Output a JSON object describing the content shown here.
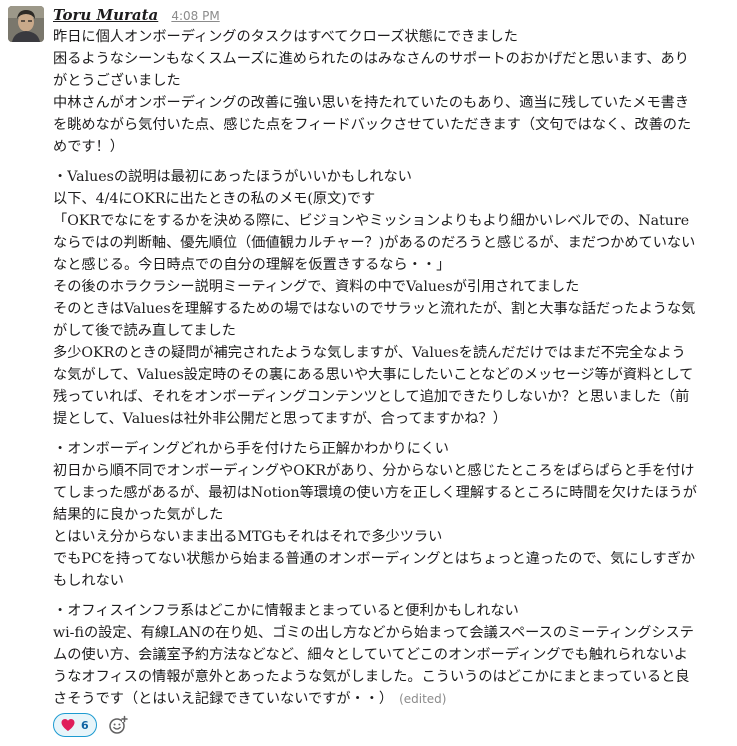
{
  "message": {
    "author": "Toru Murata",
    "timestamp": "4:08 PM",
    "paragraphs": [
      {
        "lines": [
          "昨日に個人オンボーディングのタスクはすべてクローズ状態にできました",
          "困るようなシーンもなくスムーズに進められたのはみなさんのサポートのおかげだと思います、あり",
          "がとうございました",
          "中林さんがオンボーディングの改善に強い思いを持たれていたのもあり、適当に残していたメモ書き",
          "を眺めながら気付いた点、感じた点をフィードバックさせていただきます（文句ではなく、改善のた",
          "めです！）"
        ]
      },
      {
        "lines": [
          "・Valuesの説明は最初にあったほうがいいかもしれない",
          "以下、4/4にOKRに出たときの私のメモ(原文)です",
          "「OKRでなにをするかを決める際に、ビジョンやミッションよりもより細かいレベルでの、Nature",
          "ならではの判断軸、優先順位（価値観カルチャー？)があるのだろうと感じるが、まだつかめていない",
          "なと感じる。今日時点での自分の理解を仮置きするなら・・」",
          "その後のホラクラシー説明ミーティングで、資料の中でValuesが引用されてました",
          "そのときはValuesを理解するための場ではないのでサラッと流れたが、割と大事な話だったような気",
          "がして後で読み直してました",
          "多少OKRのときの疑問が補完されたような気しますが、Valuesを読んだだけではまだ不完全なよう",
          "な気がして、Values設定時のその裏にある思いや大事にしたいことなどのメッセージ等が資料として",
          "残っていれば、それをオンボーディングコンテンツとして追加できたりしないか？と思いました（前",
          "提として、Valuesは社外非公開だと思ってますが、合ってますかね？）"
        ]
      },
      {
        "lines": [
          "・オンボーディングどれから手を付けたら正解かわかりにくい",
          "初日から順不同でオンボーディングやOKRがあり、分からないと感じたところをぱらぱらと手を付け",
          "てしまった感があるが、最初はNotion等環境の使い方を正しく理解するところに時間を欠けたほうが",
          "結果的に良かった気がした",
          "とはいえ分からないまま出るMTGもそれはそれで多少ツラい",
          "でもPCを持ってない状態から始まる普通のオンボーディングとはちょっと違ったので、気にしすぎか",
          "もしれない"
        ]
      },
      {
        "lines": [
          "・オフィスインフラ系はどこかに情報まとまっていると便利かもしれない",
          "wi-fiの設定、有線LANの在り処、ゴミの出し方などから始まって会議スペースのミーティングシステ",
          "ムの使い方、会議室予約方法などなど、細々としていてどこのオンボーディングでも触れられないよ",
          "うなオフィスの情報が意外とあったような気がしました。こういうのはどこかにまとまっていると良",
          "さそうです（とはいえ記録できていないですが・・）"
        ]
      }
    ],
    "edited_label": "(edited)",
    "reactions": [
      {
        "emoji": "heart-icon",
        "count": "6"
      }
    ]
  },
  "colors": {
    "text": "#1d1c1d",
    "muted": "#8b8b8b",
    "reaction_border": "#1d9bd1",
    "reaction_bg": "#e8f5fa",
    "reaction_count": "#1264a3",
    "heart": "#e01e5a"
  }
}
